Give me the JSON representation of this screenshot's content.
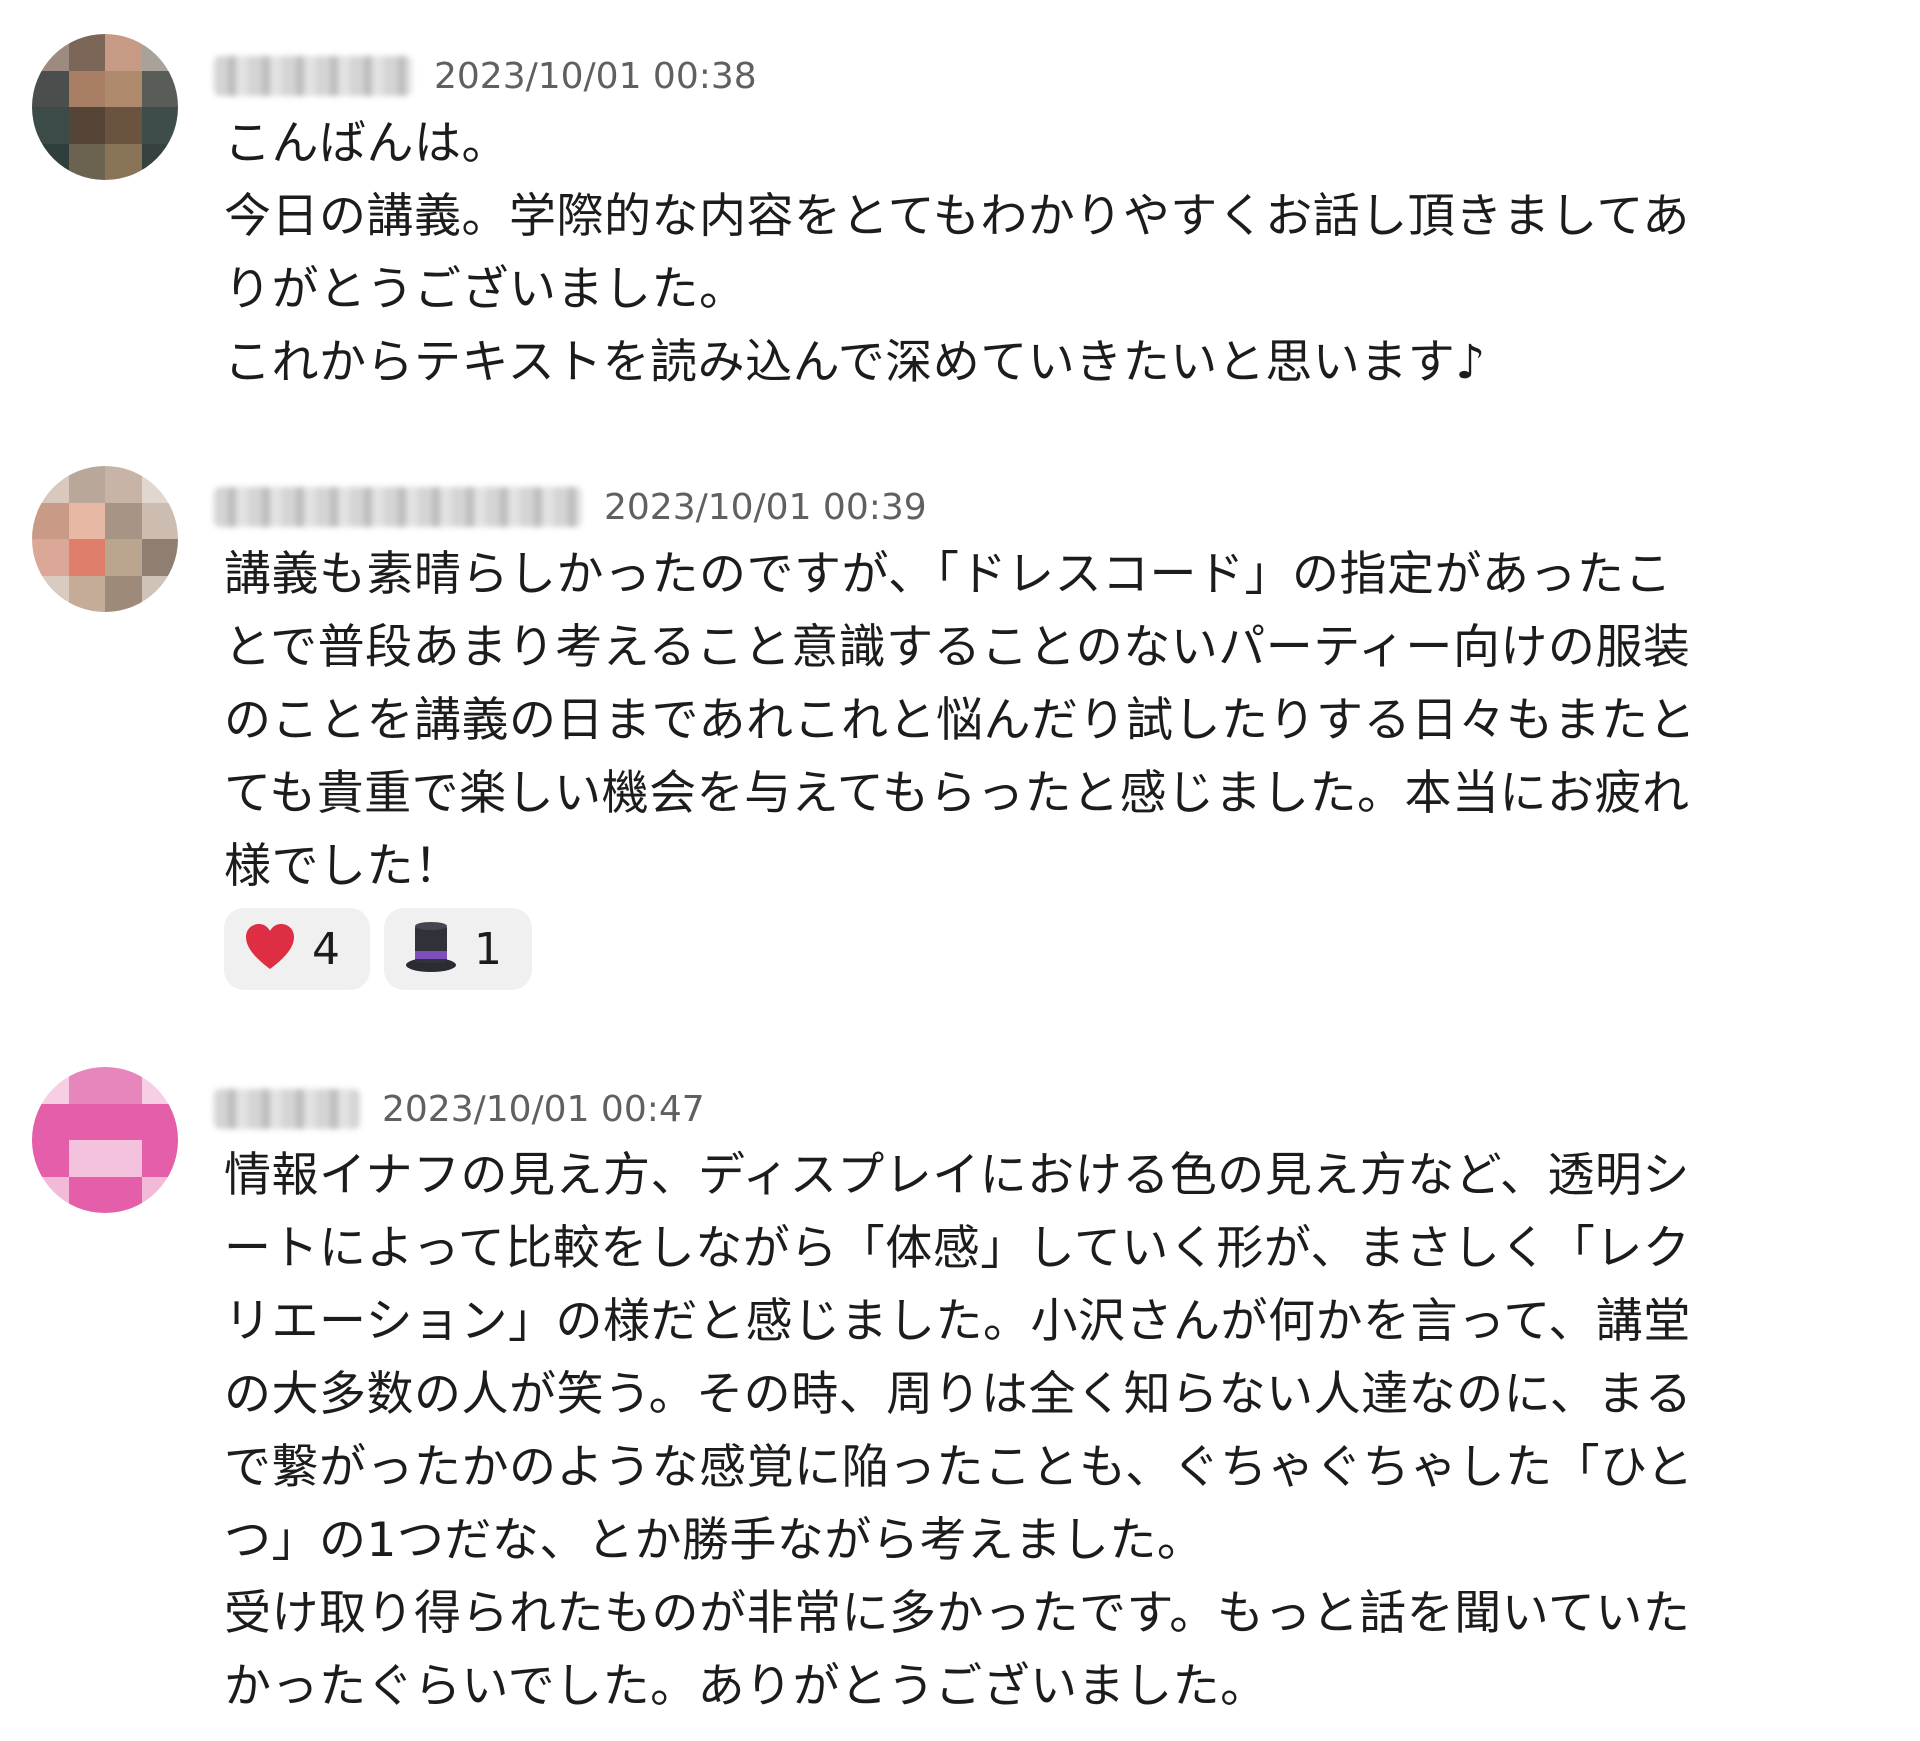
{
  "messages": [
    {
      "timestamp": "2023/10/01 00:38",
      "lines": [
        "こんばんは。",
        "今日の講義。学際的な内容をとてもわかりやすくお話し頂きましてあ",
        "りがとうございました。",
        "これからテキストを読み込んで深めていきたいと思います♪"
      ]
    },
    {
      "timestamp": "2023/10/01 00:39",
      "lines": [
        "講義も素晴らしかったのですが、「ドレスコード」の指定があったこ",
        "とで普段あまり考えること意識することのないパーティー向けの服装",
        "のことを講義の日まであれこれと悩んだり試したりする日々もまたと",
        "ても貴重で楽しい機会を与えてもらったと感じました。本当にお疲れ",
        "様でした！"
      ],
      "reactions": [
        {
          "emoji": "heart",
          "count": "4"
        },
        {
          "emoji": "top-hat",
          "count": "1"
        }
      ]
    },
    {
      "timestamp": "2023/10/01 00:47",
      "lines": [
        "情報イナフの見え方、ディスプレイにおける色の見え方など、透明シ",
        "ートによって比較をしながら「体感」していく形が、まさしく「レク",
        "リエーション」の様だと感じました。小沢さんが何かを言って、講堂",
        "の大多数の人が笑う。その時、周りは全く知らない人達なのに、まる",
        "で繋がったかのような感覚に陥ったことも、ぐちゃぐちゃした「ひと",
        "つ」の1つだな、とか勝手ながら考えました。",
        "受け取り得られたものが非常に多かったです。もっと話を聞いていた",
        "かったぐらいでした。ありがとうございました。"
      ]
    }
  ],
  "colors": {
    "text": "#1d1c1d",
    "timestamp": "#616061",
    "reaction_bg": "#f0f0f0",
    "heart": "#dd2e44",
    "avatar3_pink": "#e55ea9"
  }
}
